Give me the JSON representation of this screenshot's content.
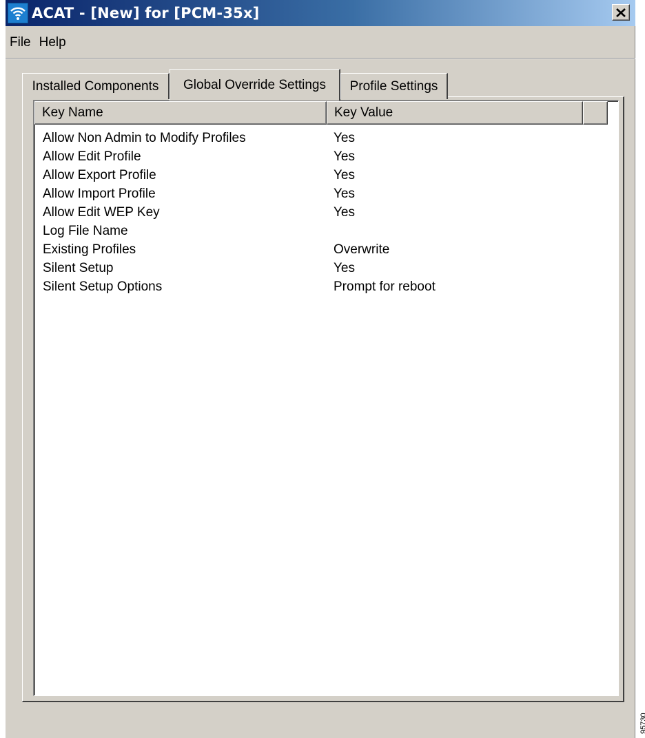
{
  "window": {
    "title": "ACAT - [New] for [PCM-35x]",
    "close_label": "✕"
  },
  "menu": {
    "items": [
      {
        "label": "File"
      },
      {
        "label": "Help"
      }
    ]
  },
  "tabs": [
    {
      "label": "Installed Components",
      "active": false
    },
    {
      "label": "Global Override Settings",
      "active": true
    },
    {
      "label": "Profile Settings",
      "active": false
    }
  ],
  "table": {
    "columns": [
      "Key Name",
      "Key Value"
    ],
    "rows": [
      {
        "name": "Allow Non Admin to Modify Profiles",
        "value": "Yes"
      },
      {
        "name": "Allow Edit Profile",
        "value": "Yes"
      },
      {
        "name": "Allow Export Profile",
        "value": "Yes"
      },
      {
        "name": "Allow Import Profile",
        "value": "Yes"
      },
      {
        "name": "Allow Edit WEP Key",
        "value": "Yes"
      },
      {
        "name": "Log File Name",
        "value": ""
      },
      {
        "name": "Existing Profiles",
        "value": "Overwrite"
      },
      {
        "name": "Silent Setup",
        "value": "Yes"
      },
      {
        "name": "Silent Setup Options",
        "value": "Prompt for reboot"
      }
    ]
  },
  "figure_id": "95730",
  "colors": {
    "titlebar_start": "#0a246a",
    "titlebar_end": "#a6caf0",
    "face": "#d4d0c8"
  },
  "icons": {
    "app": "wireless-signal-icon",
    "close": "close-icon"
  }
}
